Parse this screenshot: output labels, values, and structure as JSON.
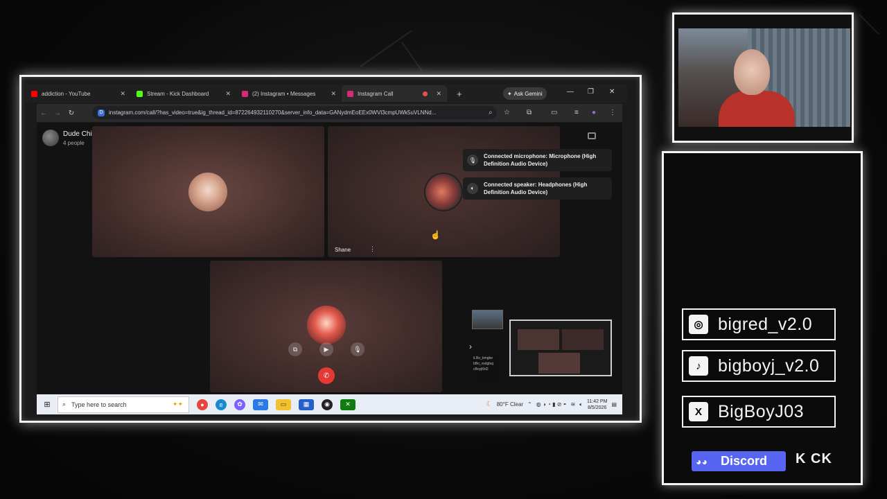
{
  "browser": {
    "tabs": [
      {
        "label": "addiction - YouTube",
        "favicon_color": "#ff0000"
      },
      {
        "label": "Stream - Kick Dashboard",
        "favicon_color": "#53fc18"
      },
      {
        "label": "(2) Instagram • Messages",
        "favicon_color": "#d62976"
      },
      {
        "label": "Instagram Call",
        "favicon_color": "#d62976"
      }
    ],
    "new_tab": "+",
    "gemini_label": "Ask Gemini",
    "url": "instagram.com/call/?has_video=true&ig_thread_id=872264932110270&server_info_data=GANydmEoEEx0WVl3cmpUWk5uVLNNd..."
  },
  "call": {
    "group_title": "Dude Chill Just Chill",
    "group_subtitle": "4 people",
    "tile_name": "Shane",
    "toasts": [
      {
        "line1": "Connected microphone: Microphone (High",
        "line2": "Definition Audio Device)"
      },
      {
        "line1": "Connected speaker: Headphones (High",
        "line2": "Definition Audio Device)"
      }
    ],
    "mini_list": [
      "iLBo_bmgbe",
      "bBo_vsdgbaj",
      "cBoyjl6d2"
    ]
  },
  "taskbar": {
    "search_placeholder": "Type here to search",
    "weather": "80°F  Clear",
    "time": "11:42 PM",
    "date": "8/5/2026"
  },
  "socials": [
    {
      "icon": "instagram-icon",
      "glyph": "◎",
      "handle": "bigred_v2.0"
    },
    {
      "icon": "tiktok-icon",
      "glyph": "♪",
      "handle": "bigboyj_v2.0"
    },
    {
      "icon": "x-icon",
      "glyph": "X",
      "handle": "BigBoyJ03"
    }
  ],
  "discord_label": "Discord",
  "kick_label": "K CK",
  "colors": {
    "end_call": "#e53935",
    "discord": "#5865f2",
    "frame": "#f4f4f4"
  }
}
